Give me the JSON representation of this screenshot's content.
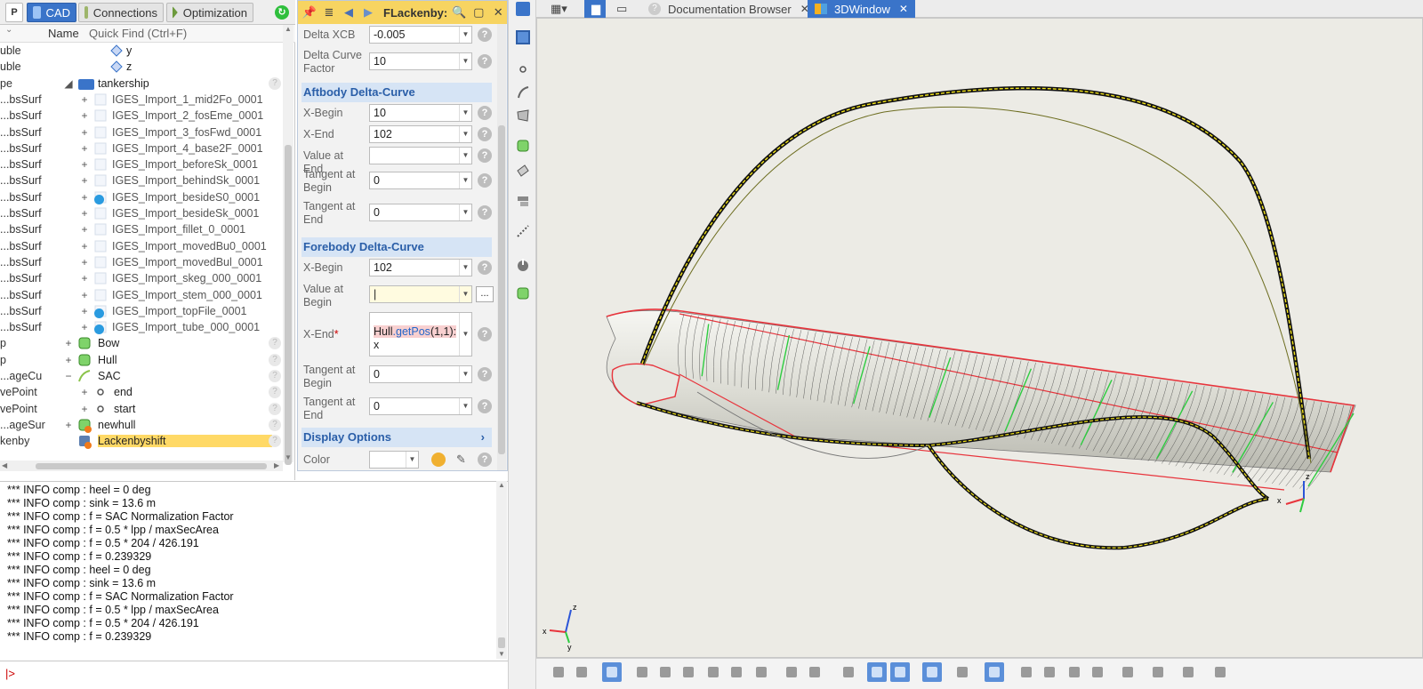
{
  "left_tabs": [
    {
      "label": "CAD"
    },
    {
      "label": "Connections"
    },
    {
      "label": "Optimization"
    }
  ],
  "tree": {
    "col_name": "Name",
    "quick_find_placeholder": "Quick Find (Ctrl+F)",
    "rows": [
      {
        "type": "uble",
        "expand": "",
        "name": "y"
      },
      {
        "type": "uble",
        "expand": "",
        "name": "z"
      },
      {
        "type": "pe",
        "expand": "◢",
        "name": "tankership"
      },
      {
        "type": "bsSurf...",
        "expand": "+",
        "name": "IGES_Import_1_mid2Fo_0001"
      },
      {
        "type": "bsSurf...",
        "expand": "+",
        "name": "IGES_Import_2_fosEme_0001"
      },
      {
        "type": "bsSurf...",
        "expand": "+",
        "name": "IGES_Import_3_fosFwd_0001"
      },
      {
        "type": "bsSurf...",
        "expand": "+",
        "name": "IGES_Import_4_base2F_0001"
      },
      {
        "type": "bsSurf...",
        "expand": "+",
        "name": "IGES_Import_beforeSk_0001"
      },
      {
        "type": "bsSurf...",
        "expand": "+",
        "name": "IGES_Import_behindSk_0001"
      },
      {
        "type": "bsSurf...",
        "expand": "+",
        "name": "IGES_Import_besideS0_0001"
      },
      {
        "type": "bsSurf...",
        "expand": "+",
        "name": "IGES_Import_besideSk_0001"
      },
      {
        "type": "bsSurf...",
        "expand": "+",
        "name": "IGES_Import_fillet_0_0001"
      },
      {
        "type": "bsSurf...",
        "expand": "+",
        "name": "IGES_Import_movedBu0_0001"
      },
      {
        "type": "bsSurf...",
        "expand": "+",
        "name": "IGES_Import_movedBul_0001"
      },
      {
        "type": "bsSurf...",
        "expand": "+",
        "name": "IGES_Import_skeg_000_0001"
      },
      {
        "type": "bsSurf...",
        "expand": "+",
        "name": "IGES_Import_stem_000_0001"
      },
      {
        "type": "bsSurf...",
        "expand": "+",
        "name": "IGES_Import_topFile_0001"
      },
      {
        "type": "bsSurf...",
        "expand": "+",
        "name": "IGES_Import_tube_000_0001"
      },
      {
        "type": "p",
        "expand": "+",
        "name": "Bow"
      },
      {
        "type": "p",
        "expand": "+",
        "name": "Hull"
      },
      {
        "type": "ageCu...",
        "expand": "−",
        "name": "SAC"
      },
      {
        "type": "vePoint",
        "expand": "+",
        "name": "end"
      },
      {
        "type": "vePoint",
        "expand": "+",
        "name": "start"
      },
      {
        "type": "ageSur...",
        "expand": "+",
        "name": "newhull"
      },
      {
        "type": "kenby",
        "expand": "",
        "name": "Lackenbyshift"
      }
    ]
  },
  "props": {
    "title": "FLackenby:",
    "delta_xcb": {
      "label": "Delta XCB",
      "value": "-0.005"
    },
    "delta_curve_factor": {
      "label": "Delta Curve Factor",
      "value": "10"
    },
    "aft_section": "Aftbody Delta-Curve",
    "aft": [
      {
        "label": "X-Begin",
        "value": "10"
      },
      {
        "label": "X-End",
        "value": "102"
      },
      {
        "label": "Value at End",
        "value": ""
      },
      {
        "label": "Tangent at Begin",
        "value": "0"
      },
      {
        "label": "Tangent at End",
        "value": "0"
      }
    ],
    "fwd_section": "Forebody Delta-Curve",
    "fwd_xbegin": {
      "label": "X-Begin",
      "value": "102"
    },
    "fwd_value_begin": {
      "label": "Value at Begin",
      "value": "|"
    },
    "fwd_xend": {
      "label": "X-End",
      "required": "*",
      "expr_obj": "Hull",
      "expr_fn": ".getPos",
      "expr_args": "(1,1):",
      "expr_tail": "x"
    },
    "fwd_tan_begin": {
      "label": "Tangent at Begin",
      "value": "0"
    },
    "fwd_tan_end": {
      "label": "Tangent at End",
      "value": "0"
    },
    "display_section": "Display Options",
    "color_label": "Color",
    "ellipsis": "..."
  },
  "console": {
    "lines": [
      "*** INFO comp : heel = 0 deg",
      "*** INFO comp : sink = 13.6 m",
      "*** INFO comp : f = SAC Normalization Factor",
      "*** INFO comp : f = 0.5 * lpp / maxSecArea",
      "*** INFO comp : f = 0.5 * 204 / 426.191",
      "*** INFO comp : f = 0.239329",
      "*** INFO comp : heel = 0 deg",
      "*** INFO comp : sink = 13.6 m",
      "*** INFO comp : f = SAC Normalization Factor",
      "*** INFO comp : f = 0.5 * lpp / maxSecArea",
      "*** INFO comp : f = 0.5 * 204 / 426.191",
      "*** INFO comp : f = 0.239329"
    ],
    "prompt": "|>"
  },
  "doc_tabs": [
    {
      "label": "Documentation Browser"
    },
    {
      "label": "3DWindow"
    }
  ],
  "axes": {
    "x": "x",
    "y": "y",
    "z": "z"
  },
  "colors": {
    "accent_blue": "#3a74c9",
    "title_yellow": "#f7d461",
    "section_blue": "#d6e4f5",
    "hull_red": "#e8343c",
    "frame_green": "#2ecc40",
    "sac_yellow": "#f5e61c"
  }
}
